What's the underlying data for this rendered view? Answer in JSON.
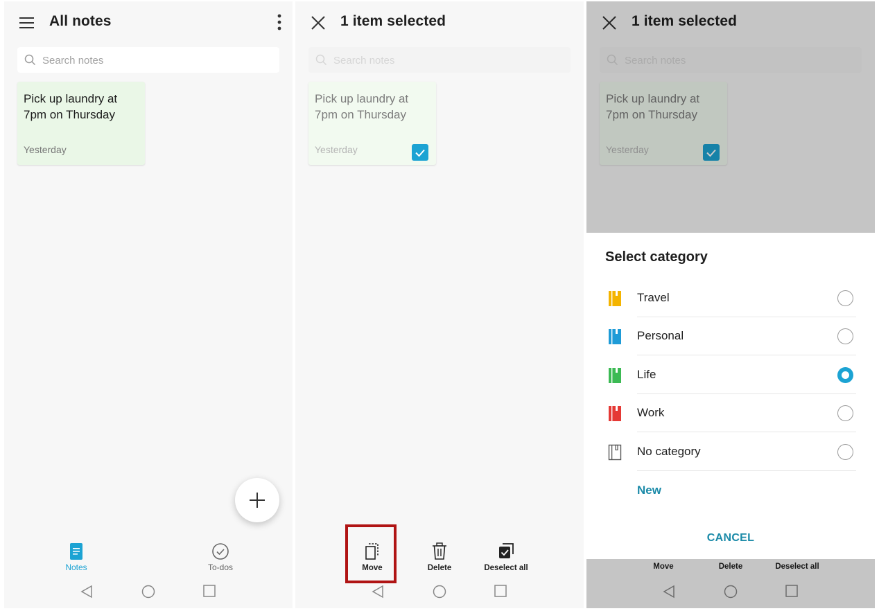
{
  "colors": {
    "accent": "#1ca3d3",
    "link": "#1a8aa8",
    "note_bg": "#eaf7e7",
    "highlight": "#b01414"
  },
  "screen1": {
    "title": "All notes",
    "search_placeholder": "Search notes",
    "note": {
      "text": "Pick up laundry at 7pm on Thursday",
      "date": "Yesterday"
    },
    "nav": {
      "notes_label": "Notes",
      "todos_label": "To-dos"
    }
  },
  "screen2": {
    "title": "1 item selected",
    "search_placeholder": "Search notes",
    "note": {
      "text": "Pick up laundry at 7pm on Thursday",
      "date": "Yesterday",
      "selected": true
    },
    "actions": {
      "move": "Move",
      "delete": "Delete",
      "deselect_all": "Deselect all"
    }
  },
  "screen3": {
    "title": "1 item selected",
    "search_placeholder": "Search notes",
    "note": {
      "text": "Pick up laundry at 7pm on Thursday",
      "date": "Yesterday",
      "selected": true
    },
    "dialog": {
      "heading": "Select category",
      "categories": [
        {
          "label": "Travel",
          "color": "#f4b400",
          "selected": false
        },
        {
          "label": "Personal",
          "color": "#1e9bd7",
          "selected": false
        },
        {
          "label": "Life",
          "color": "#3cba54",
          "selected": true
        },
        {
          "label": "Work",
          "color": "#e53935",
          "selected": false
        },
        {
          "label": "No category",
          "color": "#555555",
          "selected": false
        }
      ],
      "new_label": "New",
      "cancel_label": "CANCEL"
    },
    "actions": {
      "move": "Move",
      "delete": "Delete",
      "deselect_all": "Deselect all"
    }
  }
}
